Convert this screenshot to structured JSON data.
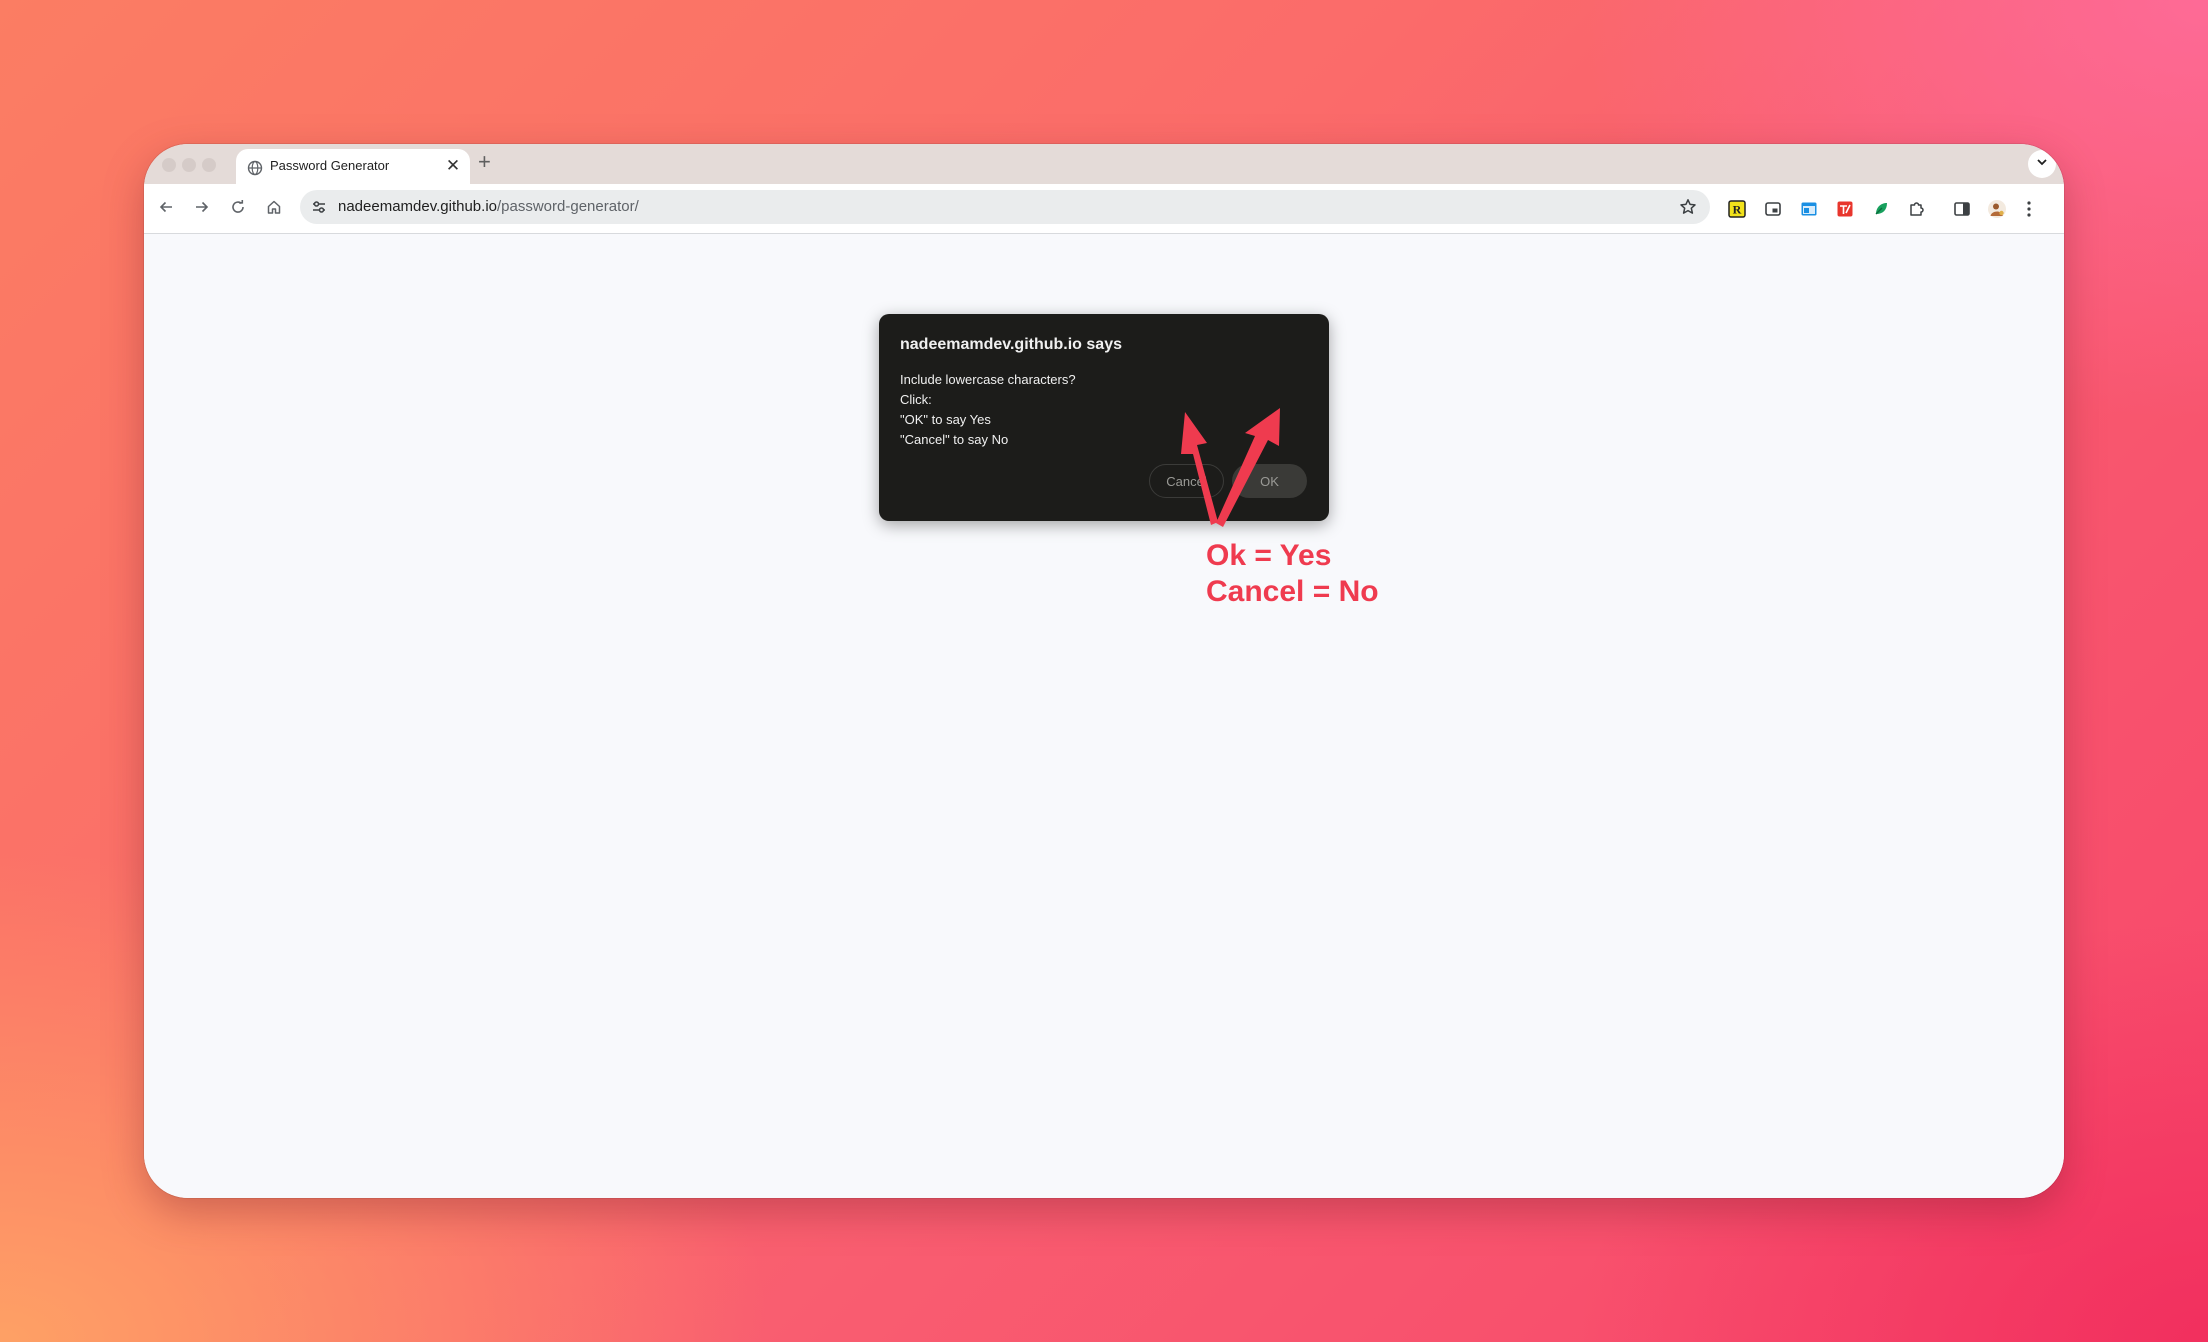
{
  "browser": {
    "tab": {
      "title": "Password Generator",
      "close_glyph": "✕",
      "favicon": "globe-icon"
    },
    "new_tab_glyph": "+",
    "address_bar": {
      "host": "nadeemamdev.github.io",
      "path": "/password-generator/"
    },
    "nav_icons": [
      "back-arrow-icon",
      "forward-arrow-icon",
      "reload-icon",
      "home-icon"
    ],
    "extension_icons": [
      "r-extension-icon",
      "picture-in-picture-icon",
      "window-extension-icon",
      "pdf-extension-icon",
      "leaf-extension-icon",
      "puzzle-icon",
      "side-panel-icon",
      "profile-avatar",
      "more-menu-icon"
    ]
  },
  "dialog": {
    "title": "nadeemamdev.github.io says",
    "message_lines": [
      "Include lowercase characters?",
      "Click:",
      "\"OK\" to say Yes",
      "\"Cancel\" to say No"
    ],
    "cancel_label": "Cancel",
    "ok_label": "OK"
  },
  "annotation": {
    "line1": "Ok = Yes",
    "line2": "Cancel = No",
    "color": "#ef3b4f"
  }
}
